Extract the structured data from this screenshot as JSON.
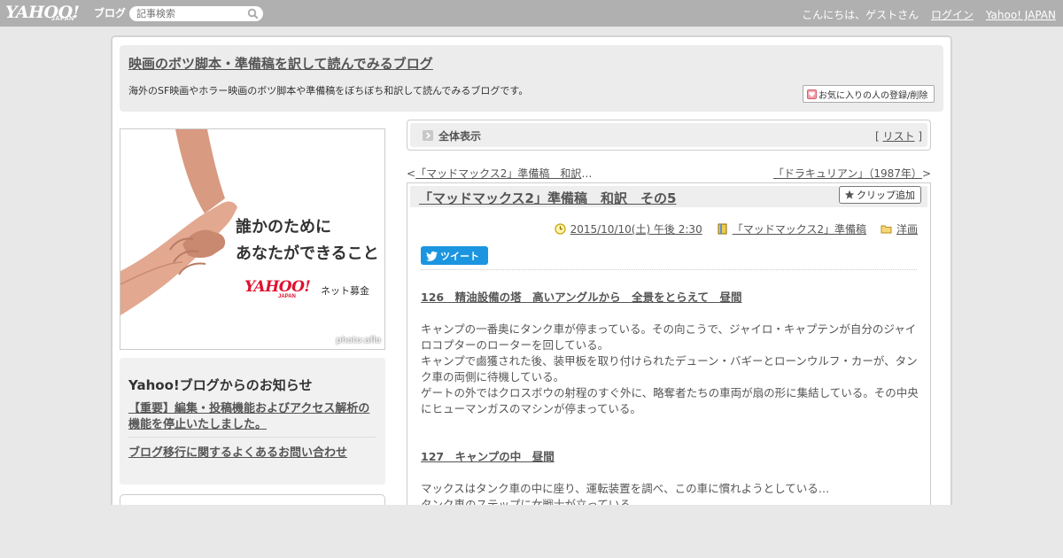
{
  "topbar": {
    "logo_text": "YAHOO!",
    "logo_sub": "JAPAN",
    "logo_blog": "ブログ",
    "search_placeholder": "記事検索",
    "greeting": "こんにちは、ゲストさん",
    "login": "ログイン",
    "yahoo_japan": "Yahoo! JAPAN"
  },
  "header": {
    "blog_title": "映画のボツ脚本・準備稿を訳して読んでみるブログ",
    "blog_description": "海外のSF映画やホラー映画のボツ脚本や準備稿をぼちぼち和訳して読んでみるブログです。",
    "favorite_button": "お気に入りの人の登録/削除"
  },
  "ad": {
    "line1": "誰かのために",
    "line2": "あなたができること",
    "logo": "YAHOO!",
    "logo_sub": "JAPAN",
    "service": "ネット募金",
    "credit": "photo:aflo"
  },
  "notice": {
    "title": "Yahoo!ブログからのお知らせ",
    "items": [
      "【重要】編集・投稿機能およびアクセス解析の機能を停止いたしました。",
      "ブログ移行に関するよくあるお問い合わせ"
    ]
  },
  "listbar": {
    "label": "全体表示",
    "list_open": "[",
    "list_link": "リスト",
    "list_close": "]"
  },
  "pager": {
    "prev_arrow": "<",
    "prev_link": "「マッドマックス2」準備稿　和訳",
    "prev_ellipsis": "…",
    "next_link": "「ドラキュリアン」（1987年）",
    "next_arrow": ">"
  },
  "article": {
    "title": "「マッドマックス2」準備稿　和訳　その5",
    "clip_button": "クリップ追加",
    "date": "2015/10/10(土) 午後 2:30",
    "category": "「マッドマックス2」準備稿",
    "genre": "洋画",
    "tweet": "ツイート",
    "scenes": [
      {
        "heading": "126　精油設備の塔　高いアングルから　全景をとらえて　昼間",
        "lines": [
          "キャンプの一番奥にタンク車が停まっている。その向こうで、ジャイロ・キャプテンが自分のジャイロコプターのローターを回している。",
          "キャンプで鹵獲された後、装甲板を取り付けられたデューン・バギーとローンウルフ・カーが、タンク車の両側に待機している。",
          "ゲートの外ではクロスボウの射程のすぐ外に、略奪者たちの車両が扇の形に集結している。その中央にヒューマンガスのマシンが停まっている。"
        ]
      },
      {
        "heading": "127　キャンプの中　昼間",
        "lines": [
          "マックスはタンク車の中に座り、運転装置を調べ、この車に慣れようとしている…",
          "タンク車のステップに女戦士が立っている。"
        ]
      }
    ]
  },
  "colors": {
    "topbar": "#b0b0b0",
    "twitter": "#1b95e0",
    "ad_red": "#e0102e",
    "panel": "#ececec"
  },
  "icons": {
    "search": "magnifier-icon",
    "favorite": "heart-icon",
    "clip": "star-icon",
    "date": "clock-icon",
    "category": "book-icon",
    "genre": "folder-icon",
    "tweet": "twitter-bird-icon",
    "listbar": "arrow-icon"
  }
}
